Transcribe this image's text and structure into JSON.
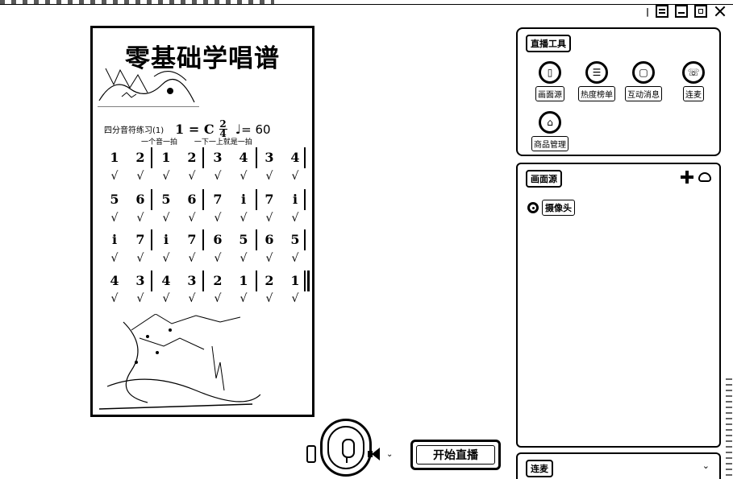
{
  "window": {
    "prefix_mark": "|",
    "buttons": [
      "menu",
      "minimize",
      "maximize",
      "close"
    ]
  },
  "preview": {
    "title": "零基础学唱谱",
    "exercise_label": "四分音符练习(1)",
    "key_signature": "1 = C",
    "time_signature": {
      "top": "2",
      "bottom": "4"
    },
    "tempo_note": "♩",
    "tempo_value": "= 60",
    "instructions": [
      "一个音一拍",
      "一下一上就是一拍"
    ],
    "rows": [
      [
        "1",
        "2",
        "1",
        "2",
        "3",
        "4",
        "3",
        "4"
      ],
      [
        "5",
        "6",
        "5",
        "6",
        "7",
        "i",
        "7",
        "i"
      ],
      [
        "i",
        "7",
        "i",
        "7",
        "6",
        "5",
        "6",
        "5"
      ],
      [
        "4",
        "3",
        "4",
        "3",
        "2",
        "1",
        "2",
        "1"
      ]
    ],
    "beat_mark": "√"
  },
  "controls": {
    "camera_icon": "camera-icon",
    "mic_icon": "microphone-icon",
    "speaker_icon": "speaker-icon",
    "speaker_chevron": "⌄",
    "start_live_label": "开始直播"
  },
  "live_tools": {
    "title": "直播工具",
    "items": [
      {
        "label": "画面源",
        "glyph": "▯"
      },
      {
        "label": "热度榜单",
        "glyph": "☰"
      },
      {
        "label": "互动消息",
        "glyph": "▢"
      },
      {
        "label": "连麦",
        "glyph": "☏"
      },
      {
        "label": "商品管理",
        "glyph": "⌂"
      }
    ]
  },
  "sources_panel": {
    "title": "画面源",
    "items": [
      {
        "label": "摄像头"
      }
    ]
  },
  "mic_panel": {
    "title": "连麦",
    "chevron": "⌄"
  }
}
